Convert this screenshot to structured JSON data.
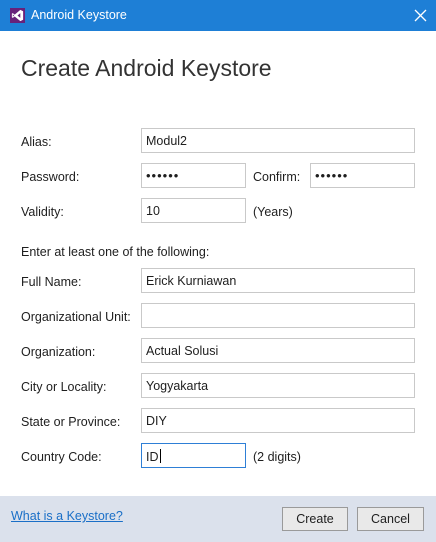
{
  "window": {
    "title": "Android Keystore",
    "close_icon": "close-icon",
    "app_icon": "visual-studio-icon"
  },
  "heading": "Create Android Keystore",
  "form": {
    "alias_label": "Alias:",
    "alias_value": "Modul2",
    "password_label": "Password:",
    "password_value": "••••••",
    "confirm_label": "Confirm:",
    "confirm_value": "••••••",
    "validity_label": "Validity:",
    "validity_value": "10",
    "validity_unit": "(Years)",
    "instruction": "Enter at least one of the following:",
    "full_name_label": "Full Name:",
    "full_name_value": "Erick Kurniawan",
    "org_unit_label": "Organizational Unit:",
    "org_unit_value": "",
    "organization_label": "Organization:",
    "organization_value": "Actual Solusi",
    "city_label": "City or Locality:",
    "city_value": "Yogyakarta",
    "state_label": "State or Province:",
    "state_value": "DIY",
    "country_label": "Country Code:",
    "country_value": "ID",
    "country_hint": "(2 digits)"
  },
  "footer": {
    "help_link": "What is a Keystore?",
    "create_button": "Create",
    "cancel_button": "Cancel"
  },
  "colors": {
    "titlebar": "#1e7fd6",
    "footer": "#dbe1ec",
    "link": "#1a6fc7",
    "focus_border": "#2e7fd6"
  }
}
